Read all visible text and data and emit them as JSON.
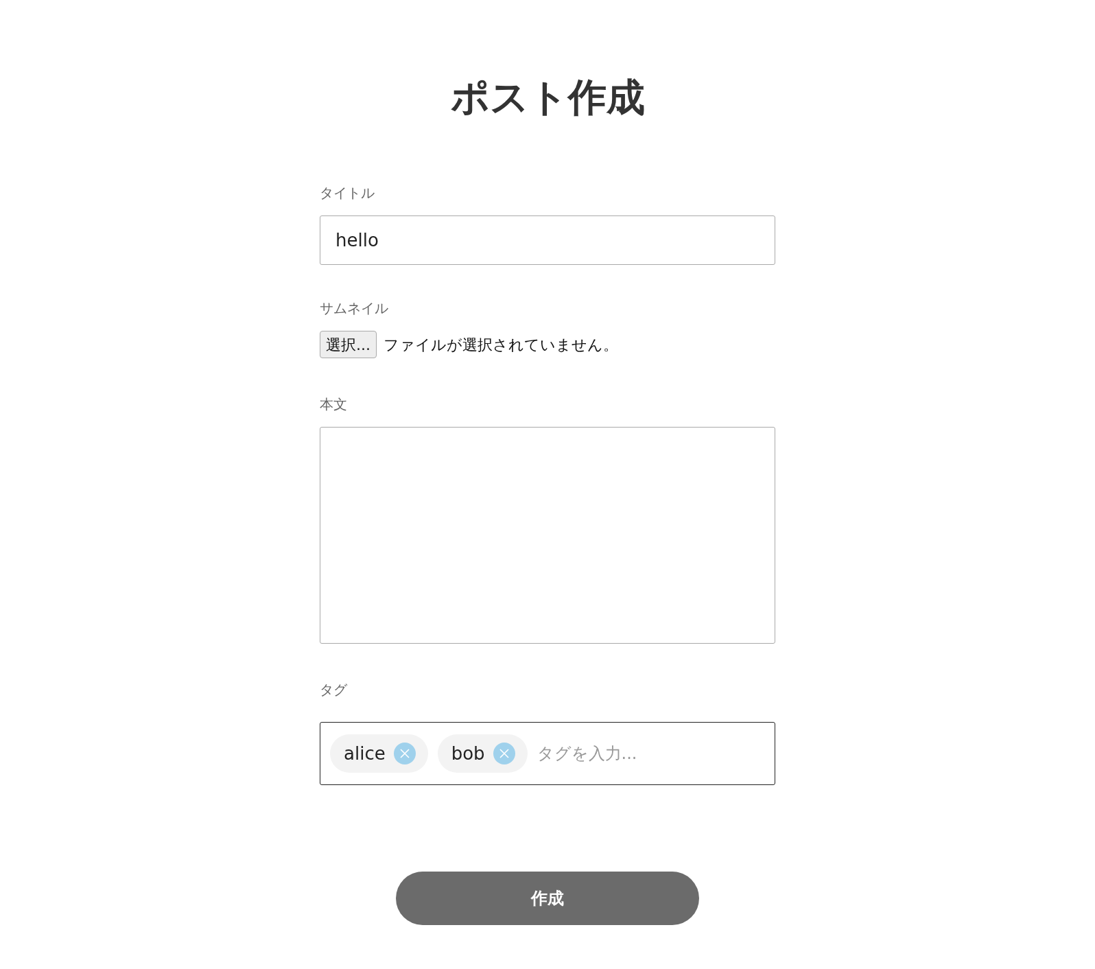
{
  "heading": "ポスト作成",
  "title_field": {
    "label": "タイトル",
    "value": "hello"
  },
  "thumbnail": {
    "label": "サムネイル",
    "button": "選択...",
    "status": "ファイルが選択されていません。"
  },
  "body_field": {
    "label": "本文"
  },
  "tags_field": {
    "label": "タグ",
    "tags": [
      {
        "label": "alice"
      },
      {
        "label": "bob"
      }
    ],
    "placeholder": "タグを入力..."
  },
  "submit": "作成"
}
